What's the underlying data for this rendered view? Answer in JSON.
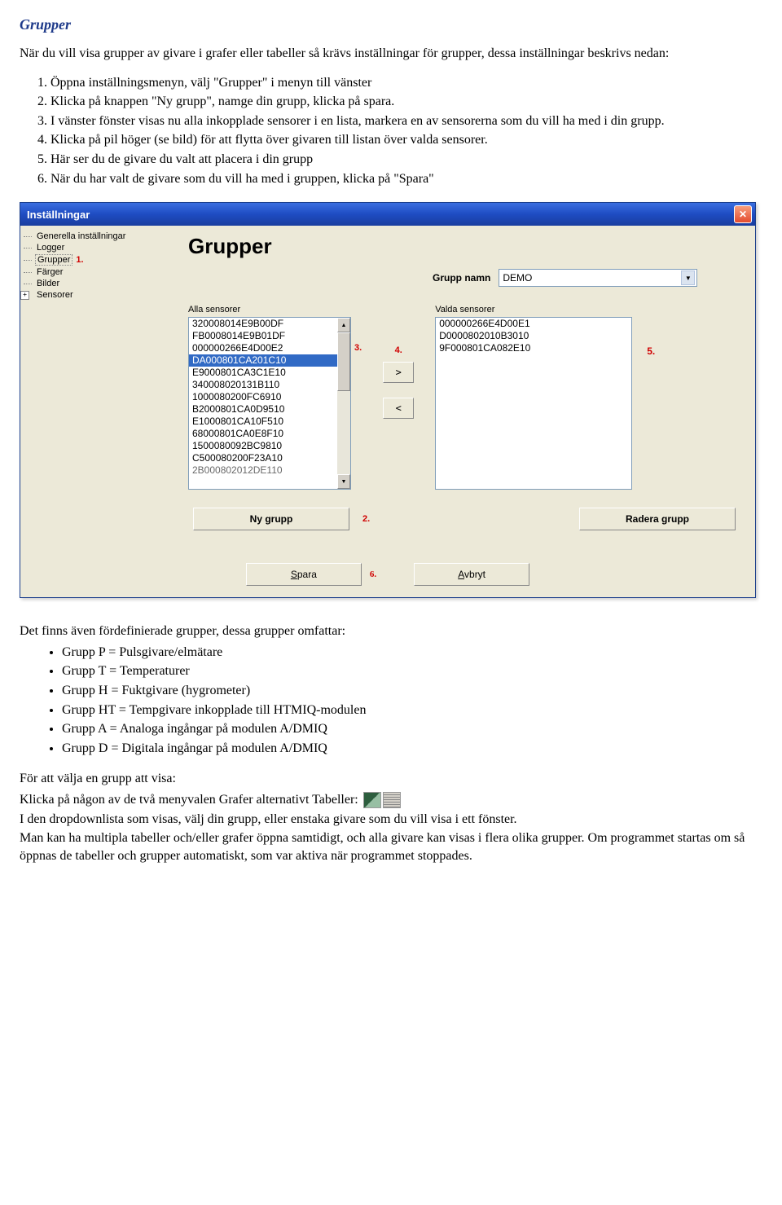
{
  "doc": {
    "heading": "Grupper",
    "intro": "När du vill visa grupper av givare i grafer eller tabeller så krävs inställningar för grupper, dessa inställningar beskrivs nedan:",
    "steps": [
      "Öppna inställningsmenyn, välj \"Grupper\" i menyn till vänster",
      "Klicka på knappen \"Ny grupp\", namge din grupp, klicka på spara.",
      "I vänster fönster visas nu alla inkopplade sensorer i en lista, markera en av sensorerna som du vill ha med i din grupp.",
      "Klicka på pil höger (se bild) för att flytta över givaren till listan över valda sensorer.",
      "Här ser du de givare du valt att placera i din grupp",
      "När du har valt de givare som du vill ha med i gruppen, klicka på \"Spara\""
    ],
    "predef_intro": "Det finns även fördefinierade grupper, dessa grupper omfattar:",
    "predef": [
      "Grupp P = Pulsgivare/elmätare",
      "Grupp T = Temperaturer",
      "Grupp H = Fuktgivare (hygrometer)",
      "Grupp HT = Tempgivare inkopplade till HTMIQ-modulen",
      "Grupp A = Analoga ingångar på modulen A/DMIQ",
      "Grupp D = Digitala ingångar på modulen A/DMIQ"
    ],
    "choose_heading": "För att välja en grupp att visa:",
    "choose_line": "Klicka på någon av de två menyvalen Grafer alternativt Tabeller:",
    "choose_para2": "I den dropdownlista som visas, välj din grupp, eller enstaka givare som du vill visa i ett fönster.",
    "choose_para3": "Man kan ha multipla tabeller och/eller grafer öppna samtidigt, och alla givare kan visas i flera olika grupper. Om programmet startas om så öppnas de tabeller och grupper automatiskt, som var aktiva när programmet stoppades."
  },
  "dialog": {
    "title": "Inställningar",
    "tree": {
      "items": [
        {
          "label": "Generella inställningar"
        },
        {
          "label": "Logger"
        },
        {
          "label": "Grupper",
          "selected": true,
          "ann": "1."
        },
        {
          "label": "Färger"
        },
        {
          "label": "Bilder"
        },
        {
          "label": "Sensorer",
          "plus": true
        }
      ]
    },
    "heading": "Grupper",
    "group_name_label": "Grupp namn",
    "group_name_value": "DEMO",
    "left_label": "Alla sensorer",
    "right_label": "Valda sensorer",
    "all_sensors": [
      "320008014E9B00DF",
      "FB0008014E9B01DF",
      "000000266E4D00E2",
      "DA000801CA201C10",
      "E9000801CA3C1E10",
      "340008020131B110",
      "1000080200FC6910",
      "B2000801CA0D9510",
      "E1000801CA10F510",
      "68000801CA0E8F10",
      "1500080092BC9810",
      "C500080200F23A10",
      "2B000802012DE110"
    ],
    "all_selected_index": 3,
    "selected_sensors": [
      "000000266E4D00E1",
      "D0000802010B3010",
      "9F000801CA082E10"
    ],
    "ann_left": "3.",
    "ann_mid": "4.",
    "ann_right": "5.",
    "btn_new": "Ny grupp",
    "ann_new": "2.",
    "btn_del": "Radera grupp",
    "btn_save_u": "S",
    "btn_save_rest": "para",
    "ann_save": "6.",
    "btn_cancel_u": "A",
    "btn_cancel_rest": "vbryt",
    "move_right": ">",
    "move_left": "<"
  }
}
